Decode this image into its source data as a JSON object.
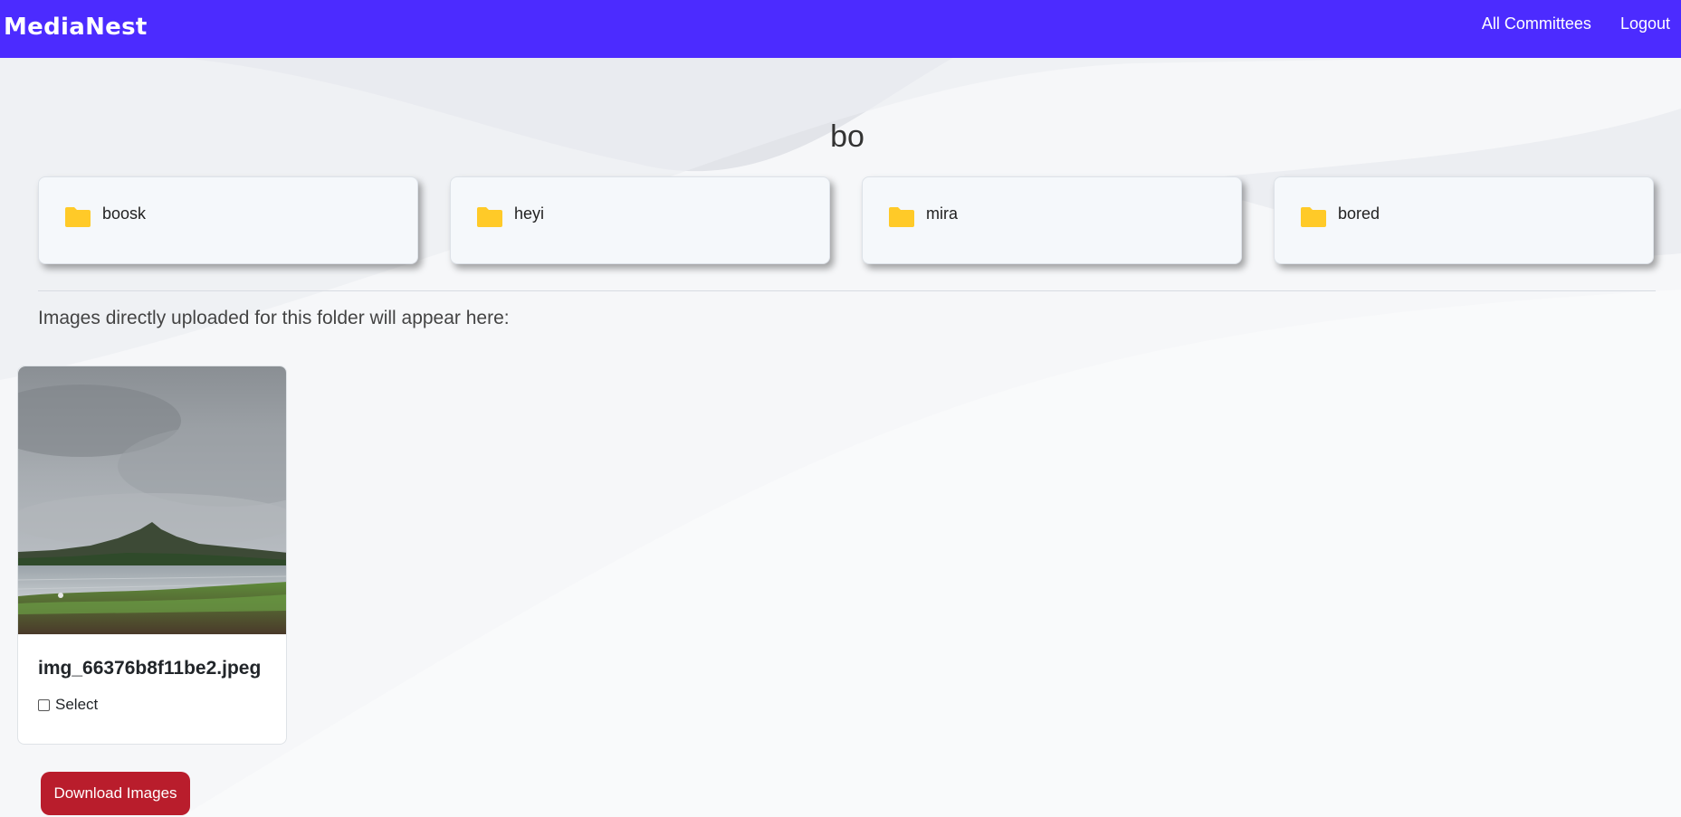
{
  "navbar": {
    "brand": "MediaNest",
    "links": [
      "All Committees",
      "Logout"
    ],
    "color": "#4c2bff"
  },
  "page": {
    "title": "bo",
    "subfolders": [
      "boosk",
      "heyi",
      "mira",
      "bored"
    ],
    "folder_icon": "folder-icon",
    "folder_icon_color": "#ffca28",
    "uploaded_note": "Images directly uploaded for this folder will appear here:"
  },
  "images": [
    {
      "filename": "img_66376b8f11be2.jpeg",
      "select_label": "Select"
    }
  ],
  "actions": {
    "download_label": "Download Images",
    "download_color": "#b91d2c"
  }
}
